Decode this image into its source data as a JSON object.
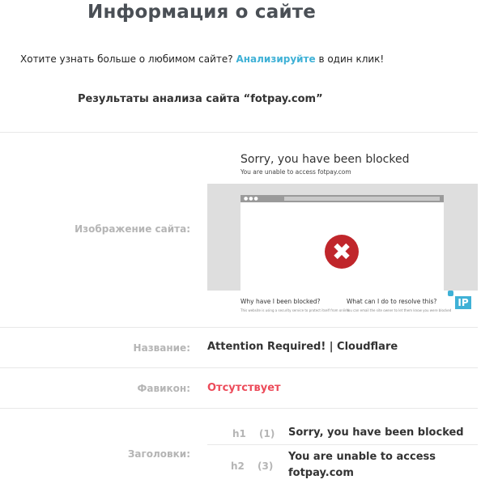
{
  "page_title": "Информация о сайте",
  "intro": {
    "before": "Хотите узнать больше о любимом сайте? ",
    "link": "Анализируйте",
    "after": " в один клик!"
  },
  "results_title": "Результаты анализа сайта “fotpay.com”",
  "rows": {
    "screenshot": {
      "label": "Изображение сайта:",
      "thumbnail": {
        "title": "Sorry, you have been blocked",
        "subtitle": "You are unable to access fotpay.com",
        "why_title": "Why have I been blocked?",
        "what_title": "What can I do to resolve this?",
        "why_body": "This website is using a security service to protect itself from online",
        "what_body": "You can email the site owner to let them know you were blocked",
        "block_color": "#c0262b",
        "block-icon": "close-icon"
      },
      "ip_badge": "IP"
    },
    "name": {
      "label": "Название:",
      "value": "Attention Required! | Cloudflare"
    },
    "favicon": {
      "label": "Фавикон:",
      "value": "Отсутствует",
      "value_color": "#ec4b5a"
    },
    "headings": {
      "label": "Заголовки:",
      "items": [
        {
          "tag": "h1",
          "count": "(1)",
          "text": "Sorry, you have been blocked"
        },
        {
          "tag": "h2",
          "count": "(3)",
          "text": "You are unable to access fotpay.com"
        }
      ]
    }
  },
  "colors": {
    "accent": "#3fb1d6",
    "label_gray": "#b5b5b5",
    "error_red": "#ec4b5a"
  }
}
